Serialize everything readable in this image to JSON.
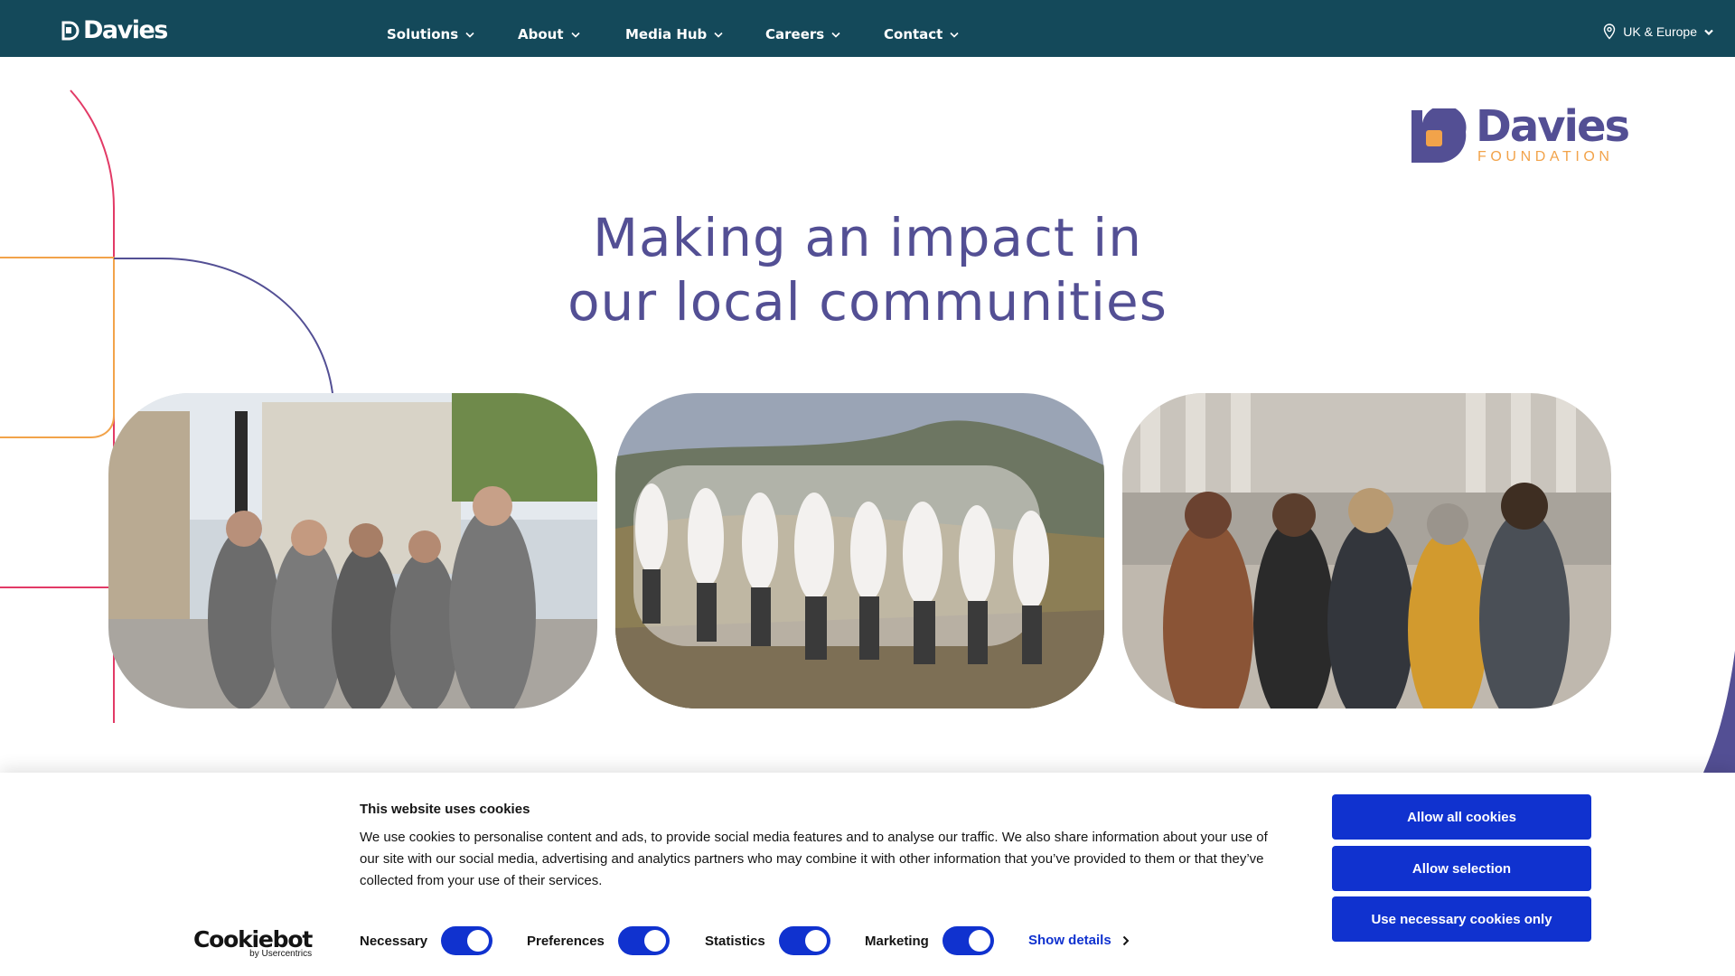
{
  "nav": {
    "brand": "Davies",
    "items": [
      {
        "label": "Solutions"
      },
      {
        "label": "About"
      },
      {
        "label": "Media Hub"
      },
      {
        "label": "Careers"
      },
      {
        "label": "Contact"
      }
    ],
    "region": "UK & Europe"
  },
  "foundation_logo": {
    "name": "Davies",
    "sub": "FOUNDATION"
  },
  "hero": {
    "title_line1": "Making an impact in",
    "title_line2": "our local communities"
  },
  "colors": {
    "nav_bg": "#14495a",
    "brand_purple": "#534f94",
    "accent_orange": "#f2a34a",
    "accent_pink": "#e23a66",
    "button_blue": "#1032cf"
  },
  "cookie": {
    "title": "This website uses cookies",
    "text": "We use cookies to personalise content and ads, to provide social media features and to analyse our traffic. We also share information about your use of our site with our social media, advertising and analytics partners who may combine it with other information that you’ve provided to them or that they’ve collected from your use of their services.",
    "logo_word": "Cookiebot",
    "logo_by": "by Usercentrics",
    "toggles": [
      {
        "label": "Necessary",
        "checked": true
      },
      {
        "label": "Preferences",
        "checked": true
      },
      {
        "label": "Statistics",
        "checked": true
      },
      {
        "label": "Marketing",
        "checked": true
      }
    ],
    "show_details": "Show details",
    "buttons": {
      "allow_all": "Allow all cookies",
      "allow_selection": "Allow selection",
      "necessary_only": "Use necessary cookies only"
    }
  }
}
